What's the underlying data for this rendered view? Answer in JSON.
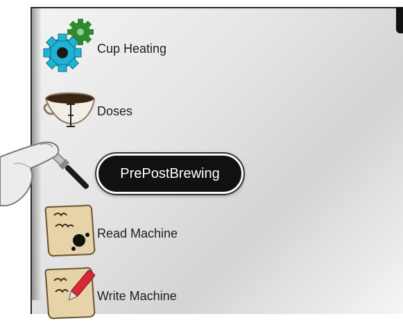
{
  "menu": {
    "items": [
      {
        "label": "Cup Heating",
        "icon": "gears-icon"
      },
      {
        "label": "Doses",
        "icon": "cup-icon"
      },
      {
        "label": "PrePostBrewing",
        "icon": "brush-icon",
        "highlighted": true
      },
      {
        "label": "Read Machine",
        "icon": "scroll-read-icon"
      },
      {
        "label": "Write Machine",
        "icon": "scroll-write-icon"
      }
    ]
  },
  "colors": {
    "gear_cyan": "#1fb3d6",
    "gear_green": "#2e8a2e",
    "bubble_bg": "#111111",
    "pen_red": "#d9273a"
  }
}
